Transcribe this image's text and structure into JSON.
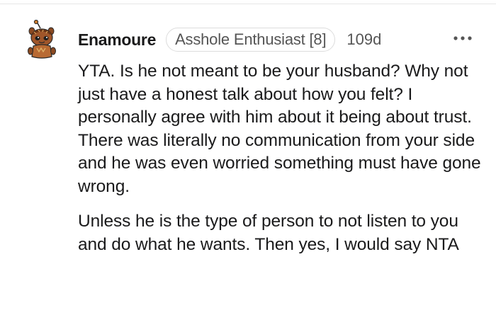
{
  "comment": {
    "author": "Enamoure",
    "flair": "Asshole Enthusiast [8]",
    "age": "109d",
    "avatar_icon": "snoo-avatar-icon",
    "more_icon": "more-options-icon",
    "paragraphs": [
      "YTA. Is he not meant to be your husband? Why not just have a honest talk about how you felt? I personally agree with him about it being about trust. There was literally no communication from your side and he was even worried something must have gone wrong.",
      "Unless he is the type of person to not listen to you and do what he wants. Then yes, I would say NTA"
    ]
  }
}
